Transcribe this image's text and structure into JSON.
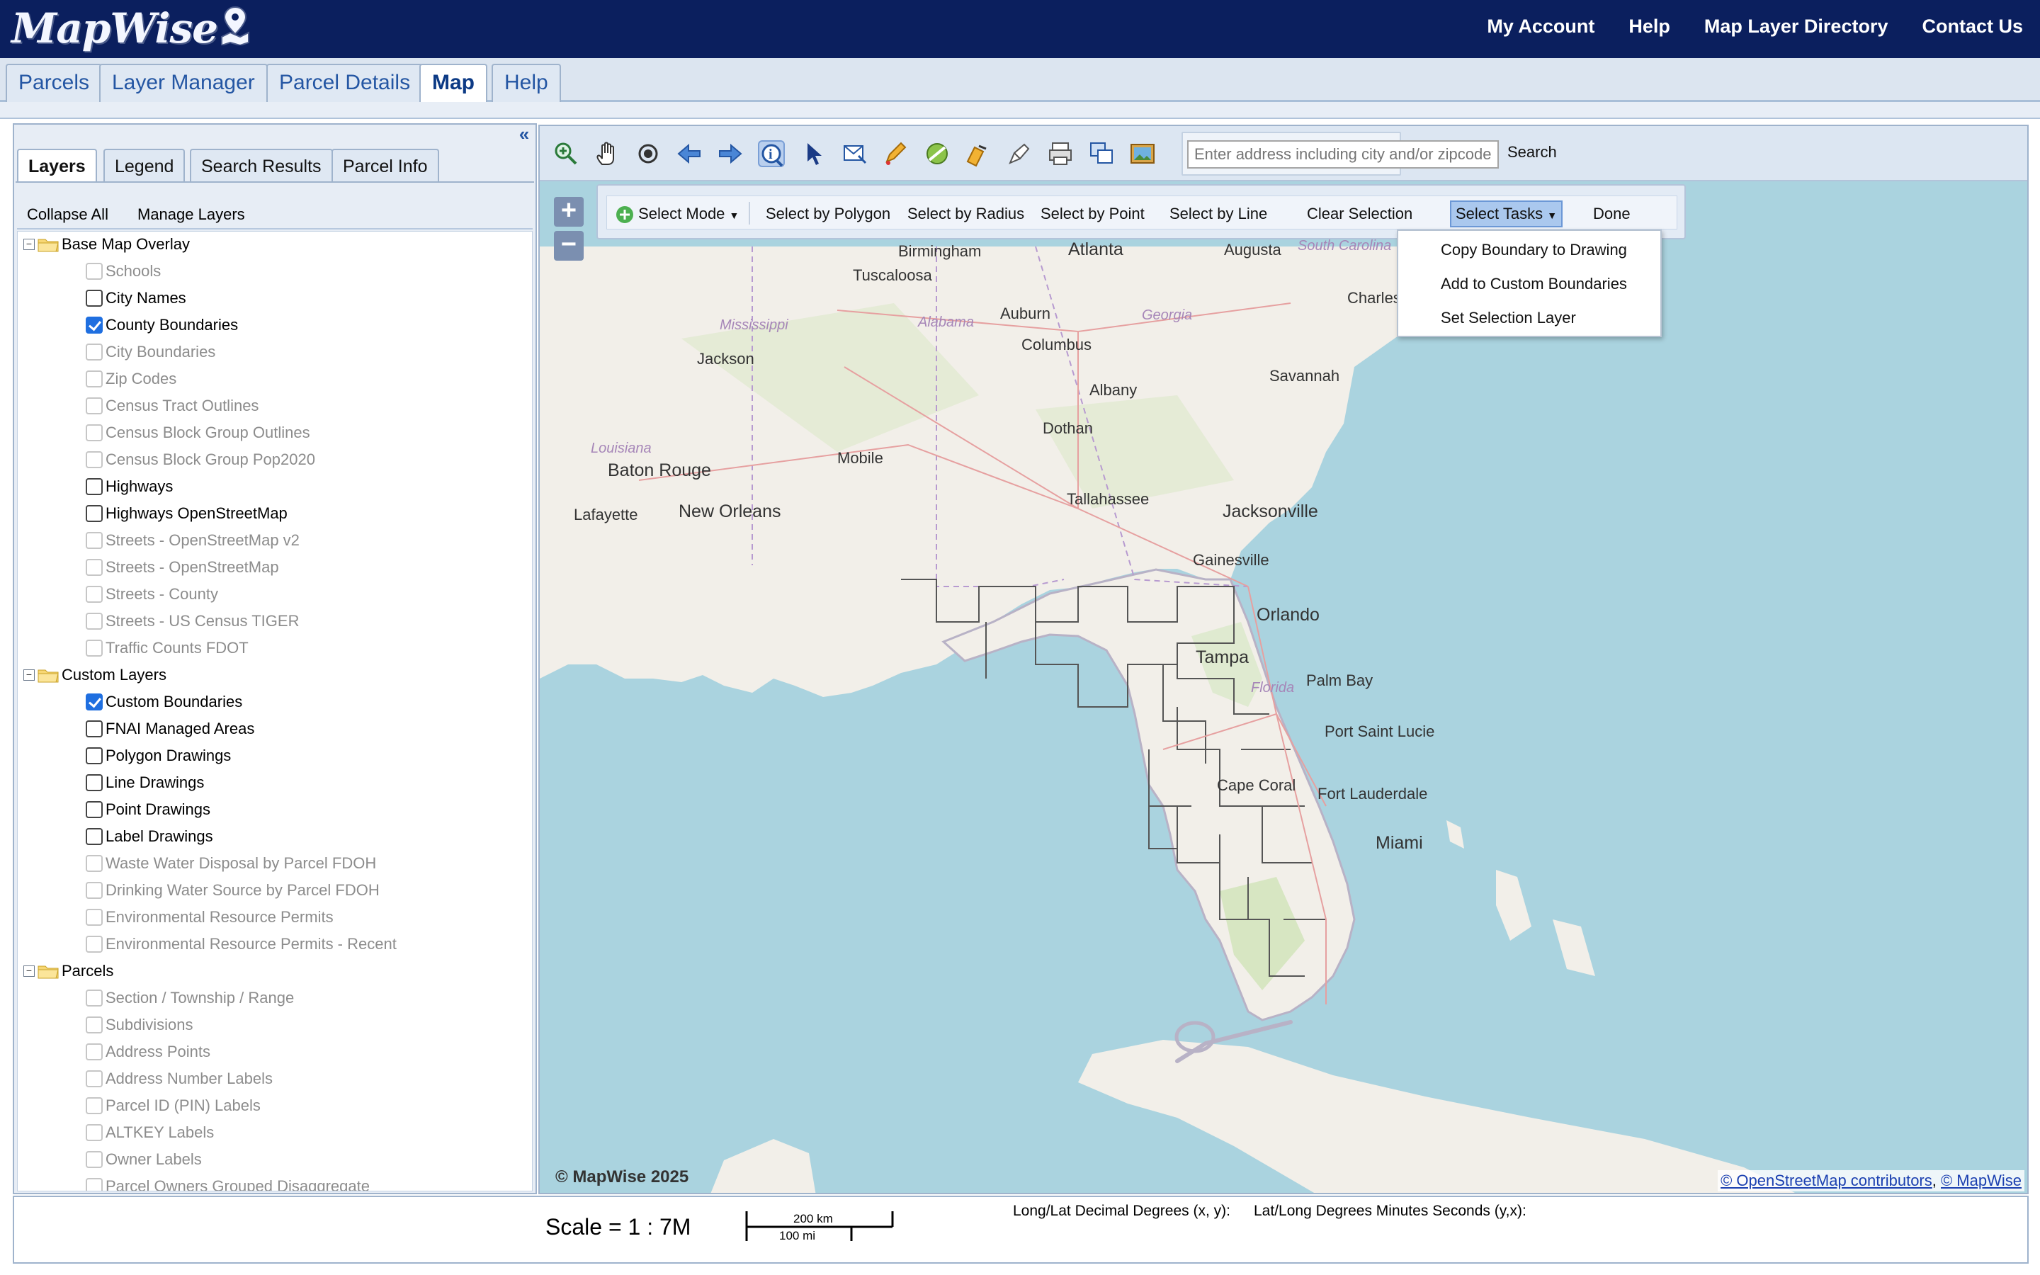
{
  "app": {
    "name": "MapWise"
  },
  "header_nav": [
    "My Account",
    "Help",
    "Map Layer Directory",
    "Contact Us"
  ],
  "main_tabs": [
    "Parcels",
    "Layer Manager",
    "Parcel Details",
    "Map",
    "Help"
  ],
  "active_main_tab": "Map",
  "left_panel": {
    "tabs": [
      "Layers",
      "Legend",
      "Search Results",
      "Parcel Info"
    ],
    "active_tab": "Layers",
    "collapse_all": "Collapse All",
    "manage_layers": "Manage Layers",
    "groups": [
      {
        "name": "Base Map Overlay",
        "layers": [
          {
            "label": "Schools",
            "checked": false,
            "enabled": false
          },
          {
            "label": "City Names",
            "checked": false,
            "enabled": true
          },
          {
            "label": "County Boundaries",
            "checked": true,
            "enabled": true
          },
          {
            "label": "City Boundaries",
            "checked": false,
            "enabled": false
          },
          {
            "label": "Zip Codes",
            "checked": false,
            "enabled": false
          },
          {
            "label": "Census Tract Outlines",
            "checked": false,
            "enabled": false
          },
          {
            "label": "Census Block Group Outlines",
            "checked": false,
            "enabled": false
          },
          {
            "label": "Census Block Group Pop2020",
            "checked": false,
            "enabled": false
          },
          {
            "label": "Highways",
            "checked": false,
            "enabled": true
          },
          {
            "label": "Highways OpenStreetMap",
            "checked": false,
            "enabled": true
          },
          {
            "label": "Streets - OpenStreetMap v2",
            "checked": false,
            "enabled": false
          },
          {
            "label": "Streets - OpenStreetMap",
            "checked": false,
            "enabled": false
          },
          {
            "label": "Streets - County",
            "checked": false,
            "enabled": false
          },
          {
            "label": "Streets - US Census TIGER",
            "checked": false,
            "enabled": false
          },
          {
            "label": "Traffic Counts FDOT",
            "checked": false,
            "enabled": false
          }
        ]
      },
      {
        "name": "Custom Layers",
        "layers": [
          {
            "label": "Custom Boundaries",
            "checked": true,
            "enabled": true
          },
          {
            "label": "FNAI Managed Areas",
            "checked": false,
            "enabled": true
          },
          {
            "label": "Polygon Drawings",
            "checked": false,
            "enabled": true
          },
          {
            "label": "Line Drawings",
            "checked": false,
            "enabled": true
          },
          {
            "label": "Point Drawings",
            "checked": false,
            "enabled": true
          },
          {
            "label": "Label Drawings",
            "checked": false,
            "enabled": true
          },
          {
            "label": "Waste Water Disposal by Parcel FDOH",
            "checked": false,
            "enabled": false
          },
          {
            "label": "Drinking Water Source by Parcel FDOH",
            "checked": false,
            "enabled": false
          },
          {
            "label": "Environmental Resource Permits",
            "checked": false,
            "enabled": false
          },
          {
            "label": "Environmental Resource Permits - Recent",
            "checked": false,
            "enabled": false
          }
        ]
      },
      {
        "name": "Parcels",
        "layers": [
          {
            "label": "Section / Township / Range",
            "checked": false,
            "enabled": false
          },
          {
            "label": "Subdivisions",
            "checked": false,
            "enabled": false
          },
          {
            "label": "Address Points",
            "checked": false,
            "enabled": false
          },
          {
            "label": "Address Number Labels",
            "checked": false,
            "enabled": false
          },
          {
            "label": "Parcel ID (PIN) Labels",
            "checked": false,
            "enabled": false
          },
          {
            "label": "ALTKEY Labels",
            "checked": false,
            "enabled": false
          },
          {
            "label": "Owner Labels",
            "checked": false,
            "enabled": false
          },
          {
            "label": "Parcel Owners Grouped Disaggregate",
            "checked": false,
            "enabled": false
          }
        ]
      }
    ]
  },
  "toolbar": {
    "icons": [
      "zoom-in-icon",
      "pan-hand-icon",
      "center-target-icon",
      "back-arrow-icon",
      "forward-arrow-icon",
      "identify-info-icon",
      "select-pointer-icon",
      "select-email-icon",
      "draw-pencil-icon",
      "measure-icon",
      "edit-drawing-icon",
      "drawing-tool-icon",
      "print-icon",
      "export-layers-icon",
      "image-export-icon"
    ],
    "search_placeholder": "Enter address including city and/or zipcode.",
    "search_button": "Search"
  },
  "select_toolbar": {
    "select_mode": "Select Mode",
    "items": [
      "Select by Polygon",
      "Select by Radius",
      "Select by Point",
      "Select by Line",
      "Clear Selection"
    ],
    "select_tasks": "Select Tasks",
    "done": "Done",
    "tasks_menu": [
      "Copy Boundary to Drawing",
      "Add to Custom Boundaries",
      "Set Selection Layer"
    ]
  },
  "map": {
    "cities": [
      "Birmingham",
      "Atlanta",
      "Augusta",
      "Tuscaloosa",
      "Charles",
      "Auburn",
      "Jackson",
      "Columbus",
      "Savannah",
      "Albany",
      "Dothan",
      "Baton Rouge",
      "Mobile",
      "Tallahassee",
      "Jacksonville",
      "Lafayette",
      "New Orleans",
      "Gainesville",
      "Orlando",
      "Tampa",
      "Palm Bay",
      "Port Saint Lucie",
      "Cape Coral",
      "Fort Lauderdale",
      "Miami"
    ],
    "states": [
      "Mississippi",
      "Alabama",
      "Georgia",
      "South Carolina",
      "Louisiana",
      "Florida"
    ],
    "copyright": "© MapWise 2025",
    "credits": [
      "© OpenStreetMap contributors",
      "© MapWise"
    ]
  },
  "status": {
    "scale": "Scale = 1 : 7M",
    "scalebar_km": "200 km",
    "scalebar_mi": "100 mi",
    "longlat_label": "Long/Lat Decimal Degrees (x, y):",
    "latlong_dms_label": "Lat/Long Degrees Minutes Seconds (y,x):"
  },
  "colors": {
    "header": "#0b1f5e",
    "water": "#aad3df",
    "land": "#f2efe9",
    "accent": "#1f6fe0"
  }
}
